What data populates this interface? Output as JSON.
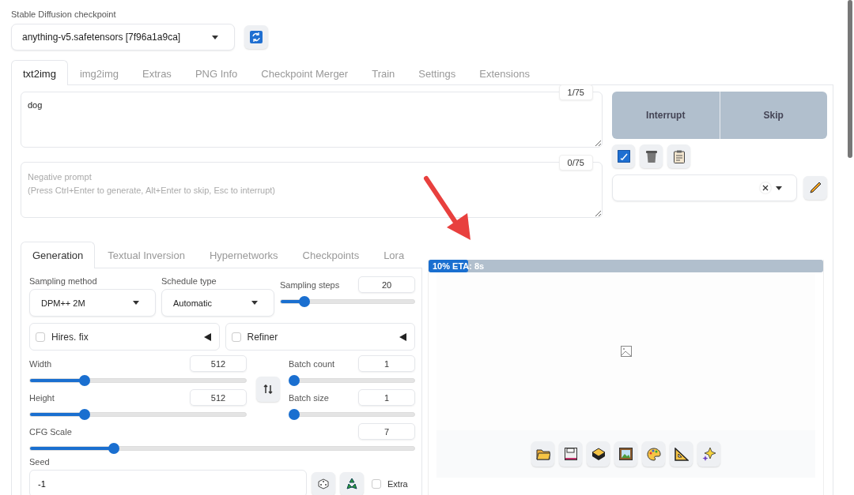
{
  "checkpoint": {
    "label": "Stable Diffusion checkpoint",
    "value": "anything-v5.safetensors [7f96a1a9ca]"
  },
  "tabs": [
    {
      "label": "txt2img",
      "selected": true
    },
    {
      "label": "img2img",
      "selected": false
    },
    {
      "label": "Extras",
      "selected": false
    },
    {
      "label": "PNG Info",
      "selected": false
    },
    {
      "label": "Checkpoint Merger",
      "selected": false
    },
    {
      "label": "Train",
      "selected": false
    },
    {
      "label": "Settings",
      "selected": false
    },
    {
      "label": "Extensions",
      "selected": false
    }
  ],
  "prompt": {
    "value": "dog",
    "counter": "1/75"
  },
  "negative_prompt": {
    "placeholder": "Negative prompt\n(Press Ctrl+Enter to generate, Alt+Enter to skip, Esc to interrupt)",
    "counter": "0/75"
  },
  "actions": [
    {
      "label": "Interrupt"
    },
    {
      "label": "Skip"
    }
  ],
  "tool_buttons": [
    {
      "kind": "checkbox",
      "checked": true
    },
    {
      "kind": "trash"
    },
    {
      "kind": "clipboard"
    }
  ],
  "generation_tabs": [
    {
      "label": "Generation",
      "selected": true
    },
    {
      "label": "Textual Inversion",
      "selected": false
    },
    {
      "label": "Hypernetworks",
      "selected": false
    },
    {
      "label": "Checkpoints",
      "selected": false
    },
    {
      "label": "Lora",
      "selected": false
    }
  ],
  "sampling_method": {
    "label": "Sampling method",
    "value": "DPM++ 2M"
  },
  "schedule_type": {
    "label": "Schedule type",
    "value": "Automatic"
  },
  "sampling_steps": {
    "label": "Sampling steps",
    "value": "20",
    "level": 0.15
  },
  "accordions": [
    {
      "label": "Hires. fix",
      "checked": false
    },
    {
      "label": "Refiner",
      "checked": false
    }
  ],
  "width": {
    "label": "Width",
    "value": "512",
    "level": 0.24
  },
  "height": {
    "label": "Height",
    "value": "512",
    "level": 0.24
  },
  "batch_count": {
    "label": "Batch count",
    "value": "1",
    "level": 0
  },
  "batch_size": {
    "label": "Batch size",
    "value": "1",
    "level": 0
  },
  "cfg_scale": {
    "label": "CFG Scale",
    "value": "7",
    "level": 0.21
  },
  "seed": {
    "label": "Seed",
    "value": "-1",
    "extra": {
      "label": "Extra",
      "checked": false
    }
  },
  "progress": {
    "text": "10% ETA: 8s",
    "level": 0.1
  },
  "gallery_buttons": [
    {
      "kind": "folder"
    },
    {
      "kind": "save"
    },
    {
      "kind": "archive"
    },
    {
      "kind": "image"
    },
    {
      "kind": "palette"
    },
    {
      "kind": "ruler"
    },
    {
      "kind": "sparkle"
    }
  ]
}
